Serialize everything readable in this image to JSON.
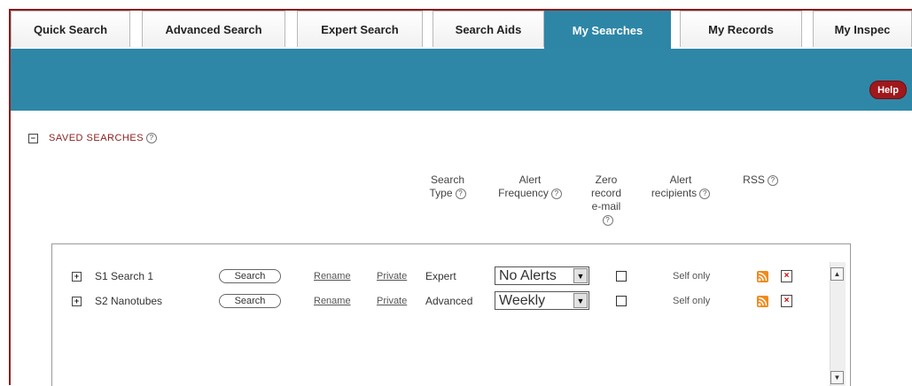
{
  "tabs": [
    {
      "label": "Quick Search",
      "active": false
    },
    {
      "label": "Advanced Search",
      "active": false
    },
    {
      "label": "Expert Search",
      "active": false
    },
    {
      "label": "Search Aids",
      "active": false
    },
    {
      "label": "My Searches",
      "active": true
    },
    {
      "label": "My Records",
      "active": false
    },
    {
      "label": "My Inspec",
      "active": false
    }
  ],
  "help_label": "Help",
  "section": {
    "title": "SAVED SEARCHES",
    "toggle": "−",
    "help": "?"
  },
  "columns": {
    "search_type": [
      "Search",
      "Type"
    ],
    "alert_frequency": [
      "Alert",
      "Frequency"
    ],
    "zero_record": [
      "Zero",
      "record",
      "e-mail"
    ],
    "alert_recipients": [
      "Alert",
      "recipients"
    ],
    "rss": "RSS"
  },
  "searches": [
    {
      "toggle": "+",
      "name": "S1 Search 1",
      "search_btn": "Search",
      "rename": "Rename",
      "privacy": "Private",
      "type": "Expert",
      "frequency": "No Alerts",
      "zero_email": false,
      "recipients": "Self only"
    },
    {
      "toggle": "+",
      "name": "S2 Nanotubes",
      "search_btn": "Search",
      "rename": "Rename",
      "privacy": "Private",
      "type": "Advanced",
      "frequency": "Weekly",
      "zero_email": false,
      "recipients": "Self only"
    }
  ],
  "colors": {
    "accent": "#2f87a8",
    "brand_red": "#a0181b",
    "rss": "#f08a1c"
  }
}
